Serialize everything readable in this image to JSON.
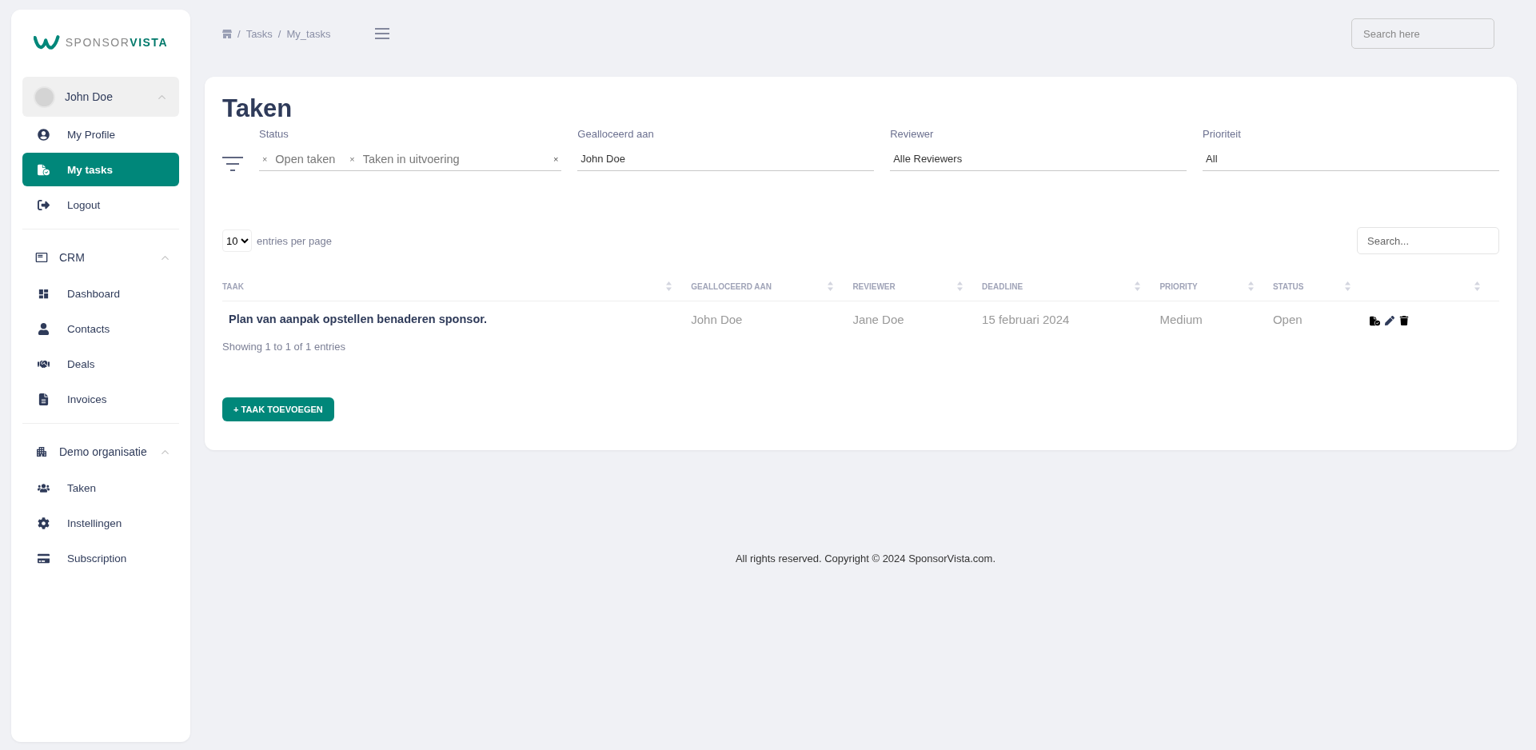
{
  "logo": {
    "light": "SPONSOR",
    "bold": "VISTA"
  },
  "user": {
    "name": "John Doe",
    "expanded": true,
    "items": [
      {
        "label": "My Profile",
        "selected": false
      },
      {
        "label": "My tasks",
        "selected": true
      },
      {
        "label": "Logout",
        "selected": false
      }
    ]
  },
  "sections": [
    {
      "title": "CRM",
      "expanded": true,
      "items": [
        {
          "label": "Dashboard",
          "selected": false
        },
        {
          "label": "Contacts",
          "selected": false
        },
        {
          "label": "Deals",
          "selected": false
        },
        {
          "label": "Invoices",
          "selected": false
        }
      ]
    },
    {
      "title": "Demo organisatie",
      "expanded": true,
      "items": [
        {
          "label": "Taken",
          "selected": false
        },
        {
          "label": "Instellingen",
          "selected": false
        },
        {
          "label": "Subscription",
          "selected": false
        }
      ]
    }
  ],
  "breadcrumb": {
    "separator": "/",
    "items": [
      "Tasks",
      "My_tasks"
    ]
  },
  "search": {
    "placeholder": "Search here"
  },
  "page_title": "Taken",
  "filters": [
    {
      "label": "Status",
      "chips": [
        {
          "remove": "×",
          "label": "Open taken"
        },
        {
          "remove": "×",
          "label": "Taken in uitvoering"
        }
      ],
      "clear": "×"
    },
    {
      "label": "Gealloceerd aan",
      "value": "John Doe"
    },
    {
      "label": "Reviewer",
      "value": "Alle Reviewers"
    },
    {
      "label": "Prioriteit",
      "value": "All"
    }
  ],
  "per_page": {
    "value": "10",
    "label": "entries per page"
  },
  "table_search": {
    "placeholder": "Search..."
  },
  "table": {
    "columns": [
      "TAAK",
      "GEALLOCEERD AAN",
      "REVIEWER",
      "DEADLINE",
      "PRIORITY",
      "STATUS",
      ""
    ],
    "rows": [
      {
        "cells": [
          "Plan van aanpak opstellen benaderen sponsor.",
          "John Doe",
          "Jane Doe",
          "15 februari 2024",
          "Medium",
          "Open"
        ]
      }
    ]
  },
  "info": "Showing 1 to 1 of 1 entries",
  "add_button": "+ TAAK TOEVOEGEN",
  "footer": "All rights reserved. Copyright © 2024 SponsorVista.com."
}
